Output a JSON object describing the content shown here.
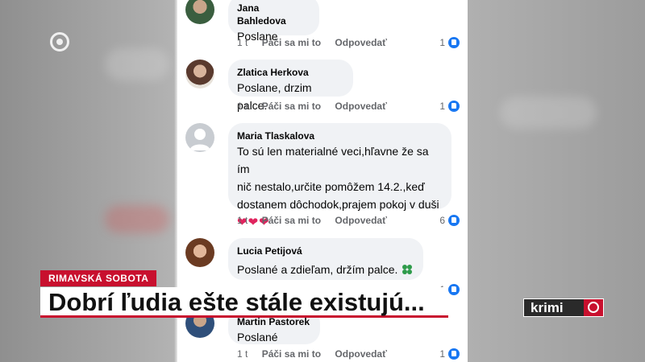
{
  "comments": [
    {
      "author": "Jana Bahledova",
      "text": "Poslane",
      "time": "1 t",
      "like_label": "Páči sa mi to",
      "reply_label": "Odpovedať",
      "likes": "1"
    },
    {
      "author": "Zlatica Herkova",
      "text": "Poslane, drzim palce.",
      "time": "1 t",
      "like_label": "Páči sa mi to",
      "reply_label": "Odpovedať",
      "likes": "1"
    },
    {
      "author": "Maria Tlaskalova",
      "text_lines": [
        "To sú len materialné veci,hľavne že sa ím",
        "nič nestalo,určite pomôžem 14.2.,keď",
        "dostanem dôchodok,prajem pokoj v duši"
      ],
      "hearts": "❤❤❤",
      "time": "1 t",
      "like_label": "Páči sa mi to",
      "reply_label": "Odpovedať",
      "likes": "6"
    },
    {
      "author": "Lucia Petijová",
      "text": "Poslané a zdieľam, držím palce.",
      "likes": "1"
    },
    {
      "author": "Martin Pastorek",
      "text": "Poslané",
      "time": "1 t",
      "like_label": "Páči sa mi to",
      "reply_label": "Odpovedať",
      "likes": "1"
    }
  ],
  "broadcast": {
    "location": "RIMAVSKÁ SOBOTA",
    "headline": "Dobrí ľudia ešte stále existujú...",
    "show_logo": "krimi"
  },
  "colors": {
    "accent": "#c8102e",
    "like_blue": "#1877f2",
    "bubble": "#f0f2f5"
  }
}
